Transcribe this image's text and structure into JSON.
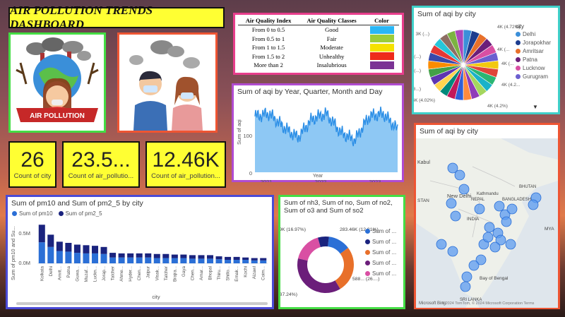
{
  "header": {
    "title": "AIR POLLUTION TRENDS DASHBOARD"
  },
  "images": {
    "left": {
      "caption": "AIR POLLUTION",
      "border": "#44dd44"
    },
    "right": {
      "border": "#ee5533"
    }
  },
  "kpis": [
    {
      "value": "26",
      "label": "Count of city"
    },
    {
      "value": "23.5...",
      "label": "Count of air_pollutio..."
    },
    {
      "value": "12.46K",
      "label": "Count of air_pollution..."
    }
  ],
  "aqi_table": {
    "headers": [
      "Air Quality Index",
      "Air Quality Classes",
      "Color"
    ],
    "rows": [
      {
        "range": "From 0 to 0.5",
        "class": "Good",
        "color": "#29b6f6"
      },
      {
        "range": "From 0.5 to 1",
        "class": "Fair",
        "color": "#9ccc3a"
      },
      {
        "range": "From 1 to 1.5",
        "class": "Moderate",
        "color": "#f5e100"
      },
      {
        "range": "From 1.5 to 2",
        "class": "Unhealthy",
        "color": "#ee2a1a"
      },
      {
        "range": "More than 2",
        "class": "Insalubrious",
        "color": "#7b3294"
      }
    ]
  },
  "pie": {
    "title": "Sum of aqi by city",
    "legend_title": "city",
    "legend": [
      {
        "name": "Delhi",
        "color": "#3b8fd9"
      },
      {
        "name": "Jorapokhar",
        "color": "#1d3d8f"
      },
      {
        "name": "Amritsar",
        "color": "#e8702a"
      },
      {
        "name": "Patna",
        "color": "#6b1e7a"
      },
      {
        "name": "Lucknow",
        "color": "#d94fa3"
      },
      {
        "name": "Gurugram",
        "color": "#6c5fd0"
      }
    ],
    "labels": [
      "4K (4.72%)",
      "3K (...)",
      "4K (...",
      "3K (...)",
      "3K (...)",
      "4K (...",
      "4K (4.2...",
      "4K (3.8...)",
      "4K (4.02%)",
      "4K (4.2%)"
    ],
    "slice_colors": [
      "#3b8fd9",
      "#1d3d8f",
      "#e8702a",
      "#6b1e7a",
      "#d94fa3",
      "#6c5fd0",
      "#f2c80f",
      "#e0453a",
      "#2bb673",
      "#1ab2c9",
      "#a4d65e",
      "#8f3bb8",
      "#ff8a3d",
      "#2f5fd9",
      "#c2185b",
      "#00897b",
      "#ffd54f",
      "#5e35b1",
      "#43a047",
      "#fb8c00",
      "#3949ab",
      "#e53935",
      "#26c6da",
      "#8d6e63",
      "#7cb342",
      "#ab47bc"
    ]
  },
  "line": {
    "title": "Sum of aqi by Year, Quarter, Month and Day",
    "ylabel": "Sum of aqi",
    "xlabel": "Year",
    "yticks": [
      "100",
      "0"
    ],
    "xticks": [
      "2021",
      "2022",
      "2023"
    ]
  },
  "bar": {
    "title": "Sum of pm10 and Sum of pm2_5 by city",
    "legend": [
      {
        "name": "Sum of pm10",
        "color": "#2b6fd6"
      },
      {
        "name": "Sum of pm2_5",
        "color": "#1a237e"
      }
    ],
    "ylabel": "Sum of pm10 and Su...",
    "yticks": [
      "0.5M",
      "0.0M"
    ],
    "xlabel": "city"
  },
  "donut": {
    "title": "Sum of nh3, Sum of no, Sum of no2, Sum of o3 and Sum of so2",
    "labels": [
      "375.39K (16.97%)",
      "283.46K (12.81%)",
      "588... (26....)",
      "824.05K (37.24%)"
    ],
    "legend": [
      {
        "name": "Sum of ...",
        "color": "#2b6fd6"
      },
      {
        "name": "Sum of ...",
        "color": "#1a237e"
      },
      {
        "name": "Sum of ...",
        "color": "#e8702a"
      },
      {
        "name": "Sum of ...",
        "color": "#6b1e7a"
      },
      {
        "name": "Sum of ...",
        "color": "#d94fa3"
      }
    ]
  },
  "map": {
    "title": "Sum of aqi by city",
    "labels": [
      "Kabul",
      "New Delhi",
      "NEPAL",
      "Kathmandu",
      "BHUTAN",
      "BANGLADESH",
      "INDIA",
      "Bay of Bengal",
      "SRI LANKA",
      "MYA",
      "STAN"
    ],
    "attribution": "© 2024 TomTom, © 2024 Microsoft Corporation  Terms",
    "logo": "Microsoft Bing"
  },
  "chart_data": [
    {
      "type": "line",
      "title": "Sum of aqi by Year, Quarter, Month and Day",
      "xlabel": "Year",
      "ylabel": "Sum of aqi",
      "x": [
        "2020-12",
        "2021-03",
        "2021-06",
        "2021-09",
        "2021-12",
        "2022-03",
        "2022-06",
        "2022-09",
        "2022-12",
        "2023-03",
        "2023-06"
      ],
      "values": [
        105,
        110,
        85,
        65,
        100,
        110,
        75,
        60,
        105,
        110,
        80
      ],
      "ylim": [
        0,
        130
      ],
      "area": true,
      "color": "#2b8ee6"
    },
    {
      "type": "bar",
      "title": "Sum of pm10 and Sum of pm2_5 by city",
      "xlabel": "city",
      "ylabel": "Sum of pm10 and Su...",
      "categories": [
        "Kolkata",
        "Delhi",
        "Amrit...",
        "Patna",
        "Guwa...",
        "Muzaf...",
        "Luckn...",
        "Jorap...",
        "Talcher",
        "Ahme...",
        "Hyder...",
        "Chen...",
        "Jaipur",
        "Visak...",
        "Talcher",
        "Brajra...",
        "Gaya",
        "Chen...",
        "Amar...",
        "Bhopal",
        "Thiru...",
        "Shillo...",
        "Ernak...",
        "Kochi",
        "Aizawl",
        "Coim..."
      ],
      "series": [
        {
          "name": "Sum of pm10",
          "values": [
            0.36,
            0.28,
            0.21,
            0.2,
            0.18,
            0.17,
            0.17,
            0.16,
            0.1,
            0.1,
            0.1,
            0.1,
            0.1,
            0.09,
            0.09,
            0.09,
            0.09,
            0.08,
            0.08,
            0.08,
            0.07,
            0.06,
            0.06,
            0.06,
            0.05,
            0.05
          ]
        },
        {
          "name": "Sum of pm2_5",
          "values": [
            0.3,
            0.21,
            0.16,
            0.15,
            0.14,
            0.14,
            0.13,
            0.12,
            0.08,
            0.07,
            0.07,
            0.07,
            0.07,
            0.07,
            0.07,
            0.06,
            0.06,
            0.06,
            0.06,
            0.06,
            0.05,
            0.05,
            0.05,
            0.04,
            0.04,
            0.04
          ]
        }
      ],
      "ylim": [
        0,
        0.7
      ]
    },
    {
      "type": "pie",
      "title": "Sum of nh3, Sum of no, Sum of no2, Sum of o3 and Sum of so2",
      "categories": [
        "Sum of nh3",
        "Sum of no",
        "Sum of no2",
        "Sum of o3",
        "Sum of so2"
      ],
      "values": [
        283.46,
        140,
        588,
        824.05,
        375.39
      ],
      "hole": true
    }
  ]
}
